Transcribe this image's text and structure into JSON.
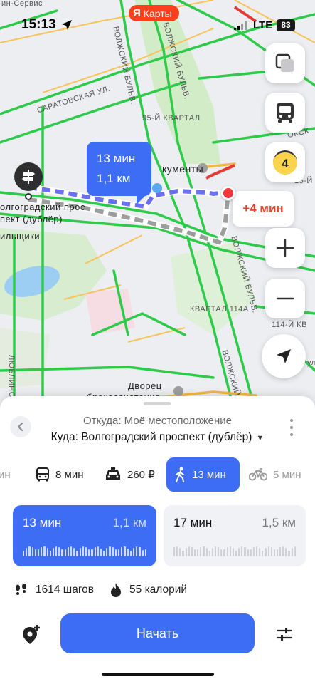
{
  "status_bar": {
    "time": "15:13",
    "network": "LTE",
    "battery": "83"
  },
  "brand": {
    "logo_letter": "Я",
    "name": "Карты"
  },
  "map": {
    "labels": {
      "service_top": "ин-Сервис",
      "saratovskaya": "САРАТОВСКАЯ УЛ.",
      "volzh_blvd_1": "ВОЛЖСКИЙ БУЛЬВ.",
      "volzh_blvd_2": "ВОЛЖСКИЙ БУЛЬВ.",
      "kvartal_95": "95-Й КВАРТАЛ",
      "documents": "кументы",
      "volgo_1": "олгоградский прос",
      "volgo_2": "пект (дублёр)",
      "builders": "ильщики",
      "kvartal_114a": "КВАРТАЛ 114А",
      "kvartal_114": "114-Й КВ",
      "lyublino": "ЛЮБЛИНС",
      "volzh_blvd_3": "ВОЛЖСКИЙ БУЛЬВ.",
      "volzh_blvd_4": "ВОЛЖСКИЙ",
      "dvorets_1": "Дворец",
      "dvorets_2": "бракосочетания",
      "okskaya": "ОКСК",
      "right_15": "15-Й",
      "right_ul": "ул"
    },
    "route_bubble": {
      "time": "13 мин",
      "distance": "1,1 км"
    },
    "alt_bubble": "+4 мин",
    "traffic_level": "4"
  },
  "sheet": {
    "from": "Откуда: Моё местоположение",
    "to": "Куда: Волгоградский проспект (дублёр)",
    "modes": [
      {
        "icon": "car-icon",
        "label": "ин"
      },
      {
        "icon": "bus-icon",
        "label": "8 мин"
      },
      {
        "icon": "taxi-icon",
        "label": "260 ₽"
      },
      {
        "icon": "walking-icon",
        "label": "13 мин"
      },
      {
        "icon": "bicycle-icon",
        "label": "5 мин"
      }
    ],
    "active_mode": "walking",
    "routes": [
      {
        "time": "13 мин",
        "distance": "1,1 км",
        "selected": true
      },
      {
        "time": "17 мин",
        "distance": "1,5 км",
        "selected": false
      }
    ],
    "stats": {
      "steps": "1614 шагов",
      "calories": "55 калорий"
    },
    "start_label": "Начать"
  },
  "colors": {
    "accent": "#3d6df5",
    "brand": "#fc3f1d",
    "alert": "#e5432c",
    "traffic_green": "#2ecb4a"
  }
}
